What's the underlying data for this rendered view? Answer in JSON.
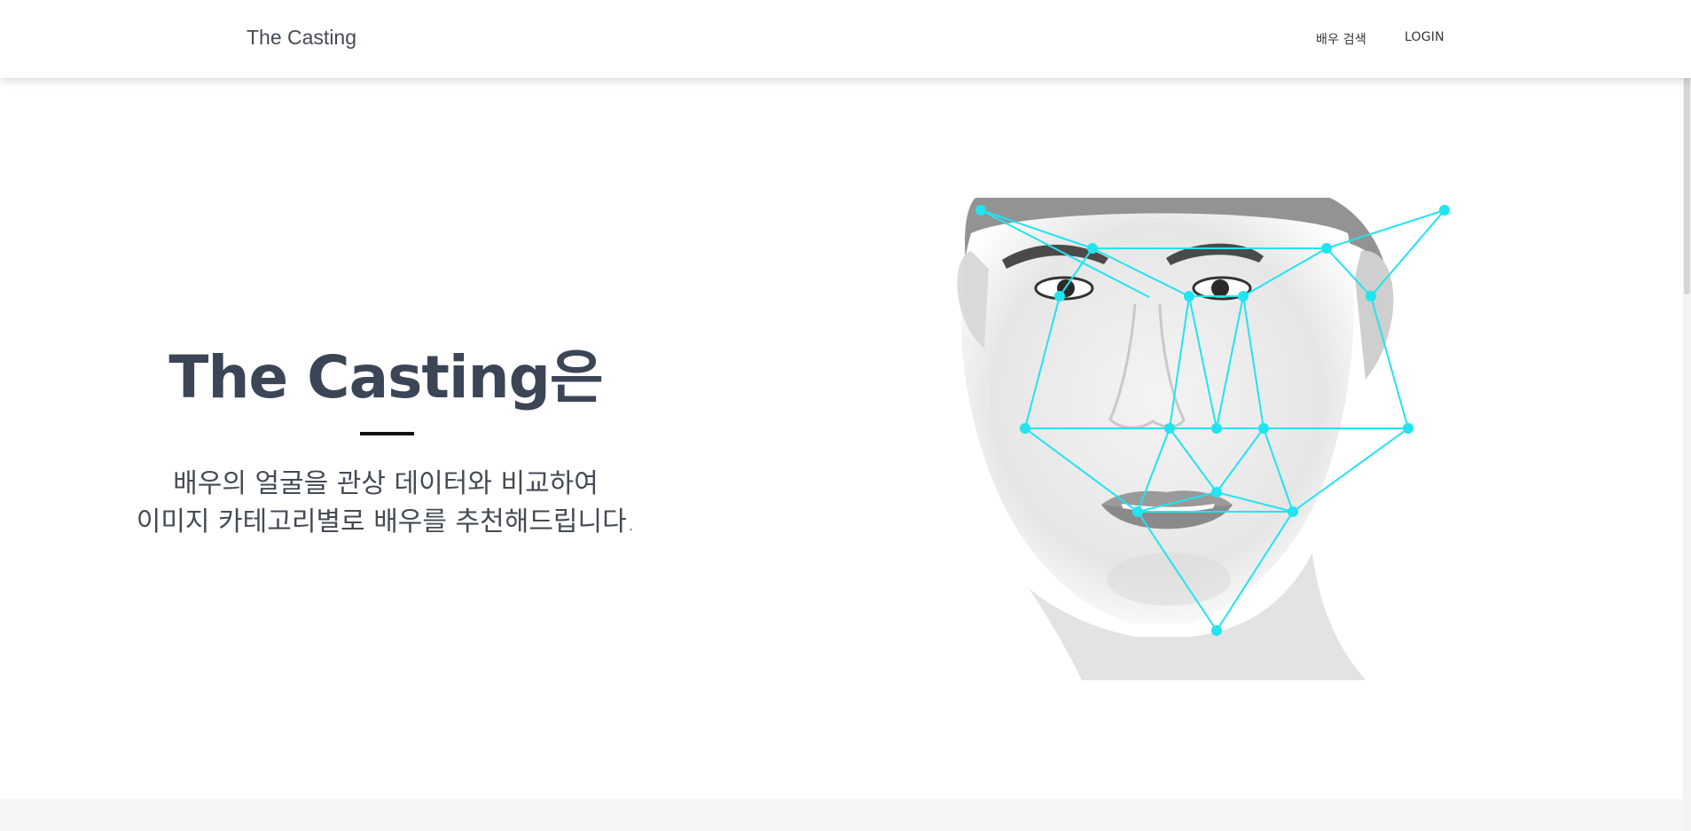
{
  "navbar": {
    "brand": "The Casting",
    "links": [
      {
        "label": "배우 검색",
        "icon": "none"
      },
      {
        "label": "LOGIN",
        "icon": "none"
      }
    ]
  },
  "hero": {
    "title": "The Casting은",
    "description_lines": [
      "배우의 얼굴을 관상 데이터와 비교하여",
      "이미지 카테고리별로 배우를 추천해드립니다."
    ]
  },
  "image": {
    "subject": "black-and-white face photo with facial landmark mesh",
    "overlay_color": "#22e3f0"
  },
  "colors": {
    "title": "#3b4556",
    "text": "#444b53",
    "accent": "#22e3f0",
    "footer_band": "#f7f6f4"
  }
}
